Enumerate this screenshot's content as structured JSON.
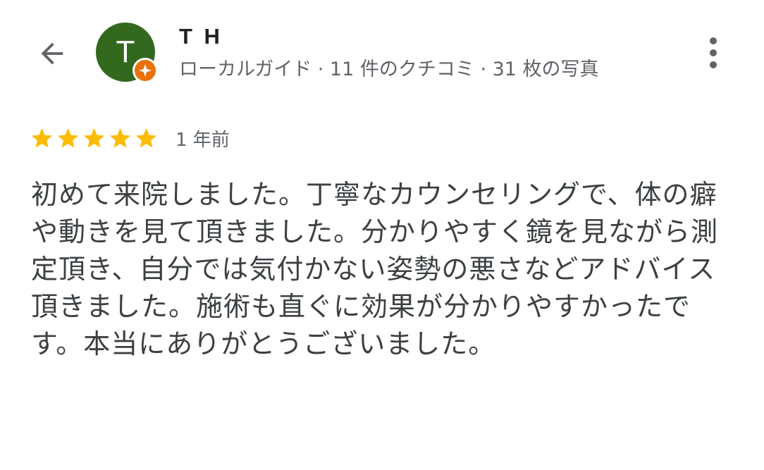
{
  "header": {
    "back_icon": "arrow-back-icon",
    "avatar_initial": "T",
    "avatar_color": "#33691e",
    "badge_icon": "local-guide-badge-icon",
    "badge_color": "#e8710a",
    "name": "T H",
    "meta": "ローカルガイド · 11 件のクチコミ · 31 枚の写真",
    "more_icon": "more-vert-icon"
  },
  "review": {
    "rating": 5,
    "max_rating": 5,
    "star_color": "#fbbc04",
    "time": "1 年前",
    "text": "初めて来院しました。丁寧なカウンセリングで、体の癖や動きを見て頂きました。分かりやすく鏡を見ながら測定頂き、自分では気付かない姿勢の悪さなどアドバイス頂きました。施術も直ぐに効果が分かりやすかったです。本当にありがとうございました。"
  }
}
